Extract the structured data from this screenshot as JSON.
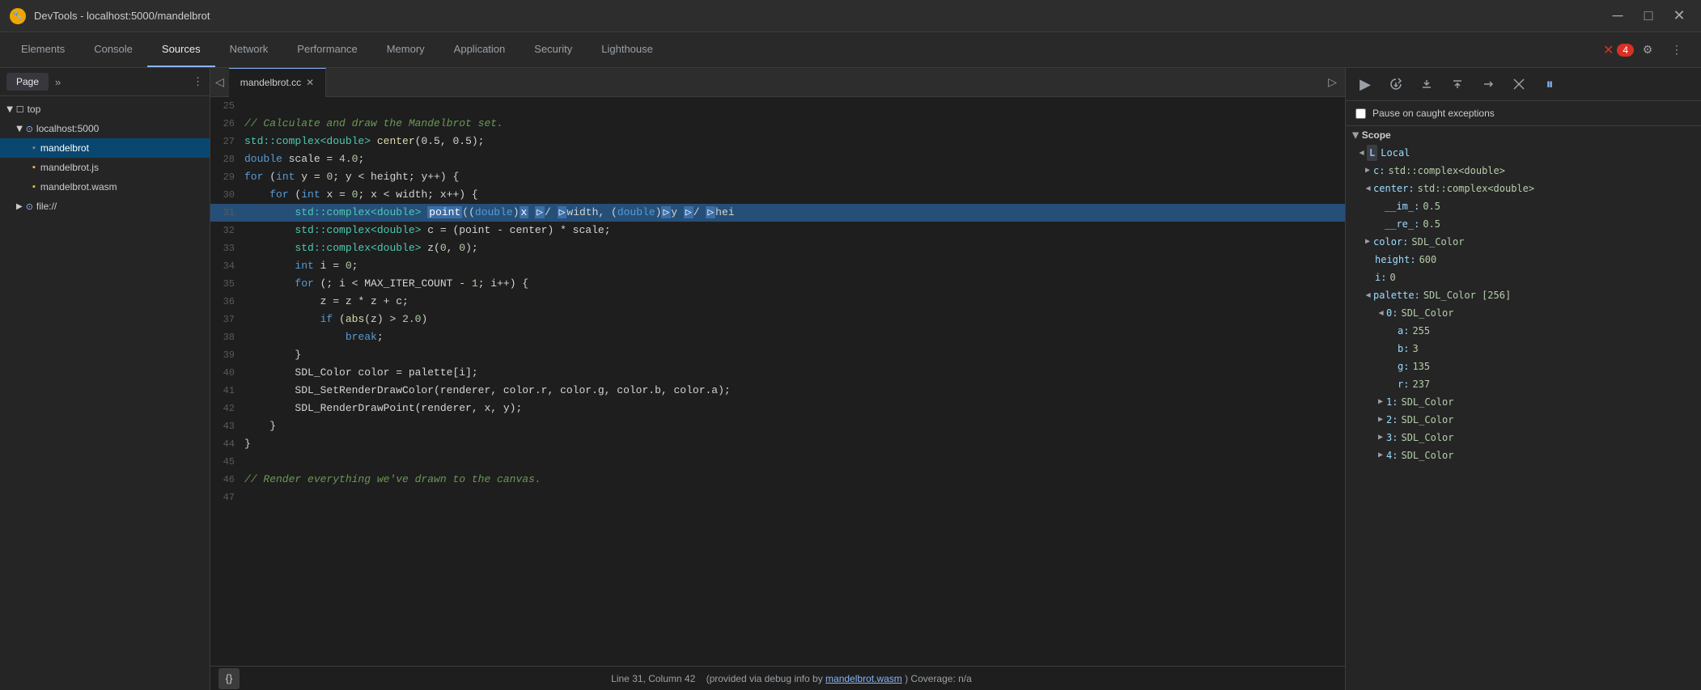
{
  "titleBar": {
    "title": "DevTools - localhost:5000/mandelbrot",
    "icon": "🔧"
  },
  "devtoolsTabs": {
    "items": [
      {
        "id": "elements",
        "label": "Elements",
        "active": false
      },
      {
        "id": "console",
        "label": "Console",
        "active": false
      },
      {
        "id": "sources",
        "label": "Sources",
        "active": true
      },
      {
        "id": "network",
        "label": "Network",
        "active": false
      },
      {
        "id": "performance",
        "label": "Performance",
        "active": false
      },
      {
        "id": "memory",
        "label": "Memory",
        "active": false
      },
      {
        "id": "application",
        "label": "Application",
        "active": false
      },
      {
        "id": "security",
        "label": "Security",
        "active": false
      },
      {
        "id": "lighthouse",
        "label": "Lighthouse",
        "active": false
      }
    ],
    "errorCount": "4",
    "settingsTitle": "Settings",
    "moreTitle": "More"
  },
  "sidebar": {
    "tabs": [
      {
        "label": "Page",
        "active": true
      },
      {
        "label": "»"
      }
    ],
    "fileTree": [
      {
        "id": "top",
        "label": "top",
        "indent": 0,
        "type": "folder",
        "open": true
      },
      {
        "id": "localhost5000",
        "label": "localhost:5000",
        "indent": 1,
        "type": "folder",
        "open": true
      },
      {
        "id": "mandelbrot",
        "label": "mandelbrot",
        "indent": 2,
        "type": "file",
        "selected": true
      },
      {
        "id": "mandelbrotjs",
        "label": "mandelbrot.js",
        "indent": 2,
        "type": "file-js"
      },
      {
        "id": "mandelbrotwasm",
        "label": "mandelbrot.wasm",
        "indent": 2,
        "type": "file-wasm"
      },
      {
        "id": "file",
        "label": "file://",
        "indent": 1,
        "type": "folder",
        "open": false
      }
    ]
  },
  "editor": {
    "fileName": "mandelbrot.cc",
    "lines": [
      {
        "num": 25,
        "tokens": []
      },
      {
        "num": 26,
        "tokens": [
          {
            "type": "comment",
            "text": "// Calculate and draw the Mandelbrot set."
          }
        ]
      },
      {
        "num": 27,
        "tokens": [
          {
            "type": "type",
            "text": "std::complex<double>"
          },
          {
            "type": "plain",
            "text": " "
          },
          {
            "type": "fn",
            "text": "center"
          },
          {
            "type": "plain",
            "text": "(0.5, 0.5);"
          }
        ]
      },
      {
        "num": 28,
        "tokens": [
          {
            "type": "kw",
            "text": "double"
          },
          {
            "type": "plain",
            "text": " scale = "
          },
          {
            "type": "num",
            "text": "4.0"
          },
          {
            "type": "plain",
            "text": ";"
          }
        ]
      },
      {
        "num": 29,
        "tokens": [
          {
            "type": "kw",
            "text": "for"
          },
          {
            "type": "plain",
            "text": " ("
          },
          {
            "type": "kw",
            "text": "int"
          },
          {
            "type": "plain",
            "text": " y = "
          },
          {
            "type": "num",
            "text": "0"
          },
          {
            "type": "plain",
            "text": "; y < height; y++) {"
          }
        ]
      },
      {
        "num": 30,
        "tokens": [
          {
            "type": "plain",
            "text": "    "
          },
          {
            "type": "kw",
            "text": "for"
          },
          {
            "type": "plain",
            "text": " ("
          },
          {
            "type": "kw",
            "text": "int"
          },
          {
            "type": "plain",
            "text": " x = "
          },
          {
            "type": "num",
            "text": "0"
          },
          {
            "type": "plain",
            "text": "; x < width; x++) {"
          }
        ]
      },
      {
        "num": 31,
        "tokens": [
          {
            "type": "plain",
            "text": "        "
          },
          {
            "type": "type",
            "text": "std::complex<double>"
          },
          {
            "type": "plain",
            "text": " point(("
          },
          {
            "type": "kw",
            "text": "double"
          },
          {
            "type": "plain",
            "text": ")x / ("
          },
          {
            "type": "kw",
            "text": "double"
          },
          {
            "type": "plain",
            "text": ")width, ("
          },
          {
            "type": "kw",
            "text": "double"
          },
          {
            "type": "plain",
            "text": ")y / ("
          },
          {
            "type": "kw",
            "text": "double"
          },
          {
            "type": "plain",
            "text": ")hei"
          }
        ],
        "highlighted": true
      },
      {
        "num": 32,
        "tokens": [
          {
            "type": "plain",
            "text": "        "
          },
          {
            "type": "type",
            "text": "std::complex<double>"
          },
          {
            "type": "plain",
            "text": " c = (point - center) * scale;"
          }
        ]
      },
      {
        "num": 33,
        "tokens": [
          {
            "type": "plain",
            "text": "        "
          },
          {
            "type": "type",
            "text": "std::complex<double>"
          },
          {
            "type": "plain",
            "text": " "
          },
          {
            "type": "fn",
            "text": "z"
          },
          {
            "type": "plain",
            "text": "("
          },
          {
            "type": "num",
            "text": "0"
          },
          {
            "type": "plain",
            "text": ", "
          },
          {
            "type": "num",
            "text": "0"
          },
          {
            "type": "plain",
            "text": ");"
          }
        ]
      },
      {
        "num": 34,
        "tokens": [
          {
            "type": "plain",
            "text": "        "
          },
          {
            "type": "kw",
            "text": "int"
          },
          {
            "type": "plain",
            "text": " i = "
          },
          {
            "type": "num",
            "text": "0"
          },
          {
            "type": "plain",
            "text": ";"
          }
        ]
      },
      {
        "num": 35,
        "tokens": [
          {
            "type": "plain",
            "text": "        "
          },
          {
            "type": "kw",
            "text": "for"
          },
          {
            "type": "plain",
            "text": " (; i < MAX_ITER_COUNT - "
          },
          {
            "type": "num",
            "text": "1"
          },
          {
            "type": "plain",
            "text": "; i++) {"
          }
        ]
      },
      {
        "num": 36,
        "tokens": [
          {
            "type": "plain",
            "text": "            z = z * z + c;"
          }
        ]
      },
      {
        "num": 37,
        "tokens": [
          {
            "type": "plain",
            "text": "            "
          },
          {
            "type": "kw",
            "text": "if"
          },
          {
            "type": "plain",
            "text": " ("
          },
          {
            "type": "fn",
            "text": "abs"
          },
          {
            "type": "plain",
            "text": "(z) > "
          },
          {
            "type": "num",
            "text": "2.0"
          },
          {
            "type": "plain",
            "text": ")"
          }
        ]
      },
      {
        "num": 38,
        "tokens": [
          {
            "type": "plain",
            "text": "                "
          },
          {
            "type": "kw",
            "text": "break"
          },
          {
            "type": "plain",
            "text": ";"
          }
        ]
      },
      {
        "num": 39,
        "tokens": [
          {
            "type": "plain",
            "text": "        }"
          }
        ]
      },
      {
        "num": 40,
        "tokens": [
          {
            "type": "plain",
            "text": "        SDL_Color color = palette[i];"
          }
        ]
      },
      {
        "num": 41,
        "tokens": [
          {
            "type": "plain",
            "text": "        SDL_SetRenderDrawColor(renderer, color.r, color.g, color.b, color.a);"
          }
        ]
      },
      {
        "num": 42,
        "tokens": [
          {
            "type": "plain",
            "text": "        SDL_RenderDrawPoint(renderer, x, y);"
          }
        ]
      },
      {
        "num": 43,
        "tokens": [
          {
            "type": "plain",
            "text": "    }"
          }
        ]
      },
      {
        "num": 44,
        "tokens": [
          {
            "type": "plain",
            "text": "}"
          }
        ]
      },
      {
        "num": 45,
        "tokens": []
      },
      {
        "num": 46,
        "tokens": [
          {
            "type": "comment",
            "text": "// Render everything we've drawn to the canvas."
          }
        ]
      },
      {
        "num": 47,
        "tokens": []
      }
    ]
  },
  "statusBar": {
    "formatLabel": "{}",
    "positionText": "Line 31, Column 42",
    "debugInfoText": "(provided via debug info by",
    "debugInfoLink": "mandelbrot.wasm",
    "coverageText": ") Coverage: n/a"
  },
  "debuggerToolbar": {
    "buttons": [
      {
        "id": "resume",
        "icon": "▶",
        "title": "Resume"
      },
      {
        "id": "step-over",
        "icon": "↩",
        "title": "Step over"
      },
      {
        "id": "step-into",
        "icon": "↓",
        "title": "Step into"
      },
      {
        "id": "step-out",
        "icon": "↑",
        "title": "Step out"
      },
      {
        "id": "step",
        "icon": "→",
        "title": "Step"
      },
      {
        "id": "deactivate",
        "icon": "⊘",
        "title": "Deactivate breakpoints"
      },
      {
        "id": "pause",
        "icon": "⏸",
        "title": "Pause on exceptions",
        "active": true
      }
    ]
  },
  "exceptions": {
    "label": "Pause on caught exceptions",
    "checked": false
  },
  "scope": {
    "sectionLabel": "Scope",
    "localLabel": "Local",
    "items": [
      {
        "key": "c:",
        "val": "std::complex<double>",
        "indent": 0,
        "expandable": true,
        "open": false
      },
      {
        "key": "center:",
        "val": "std::complex<double>",
        "indent": 0,
        "expandable": true,
        "open": true
      },
      {
        "key": "__im_:",
        "val": "0.5",
        "indent": 1,
        "expandable": false,
        "isNum": true
      },
      {
        "key": "__re_:",
        "val": "0.5",
        "indent": 1,
        "expandable": false,
        "isNum": true
      },
      {
        "key": "color:",
        "val": "SDL_Color",
        "indent": 0,
        "expandable": true,
        "open": false
      },
      {
        "key": "height:",
        "val": "600",
        "indent": 0,
        "expandable": false,
        "isNum": true
      },
      {
        "key": "i:",
        "val": "0",
        "indent": 0,
        "expandable": false,
        "isNum": true
      },
      {
        "key": "palette:",
        "val": "SDL_Color [256]",
        "indent": 0,
        "expandable": true,
        "open": true
      },
      {
        "key": "▼ 0:",
        "val": "SDL_Color",
        "indent": 1,
        "expandable": true,
        "open": true
      },
      {
        "key": "a:",
        "val": "255",
        "indent": 2,
        "expandable": false,
        "isNum": true
      },
      {
        "key": "b:",
        "val": "3",
        "indent": 2,
        "expandable": false,
        "isNum": true
      },
      {
        "key": "g:",
        "val": "135",
        "indent": 2,
        "expandable": false,
        "isNum": true
      },
      {
        "key": "r:",
        "val": "237",
        "indent": 2,
        "expandable": false,
        "isNum": true
      },
      {
        "key": "▶ 1:",
        "val": "SDL_Color",
        "indent": 1,
        "expandable": true,
        "open": false
      },
      {
        "key": "▶ 2:",
        "val": "SDL_Color",
        "indent": 1,
        "expandable": true,
        "open": false
      },
      {
        "key": "▶ 3:",
        "val": "SDL_Color",
        "indent": 1,
        "expandable": true,
        "open": false
      },
      {
        "key": "▶ 4:",
        "val": "SDL_Color",
        "indent": 1,
        "expandable": true,
        "open": false
      }
    ]
  }
}
